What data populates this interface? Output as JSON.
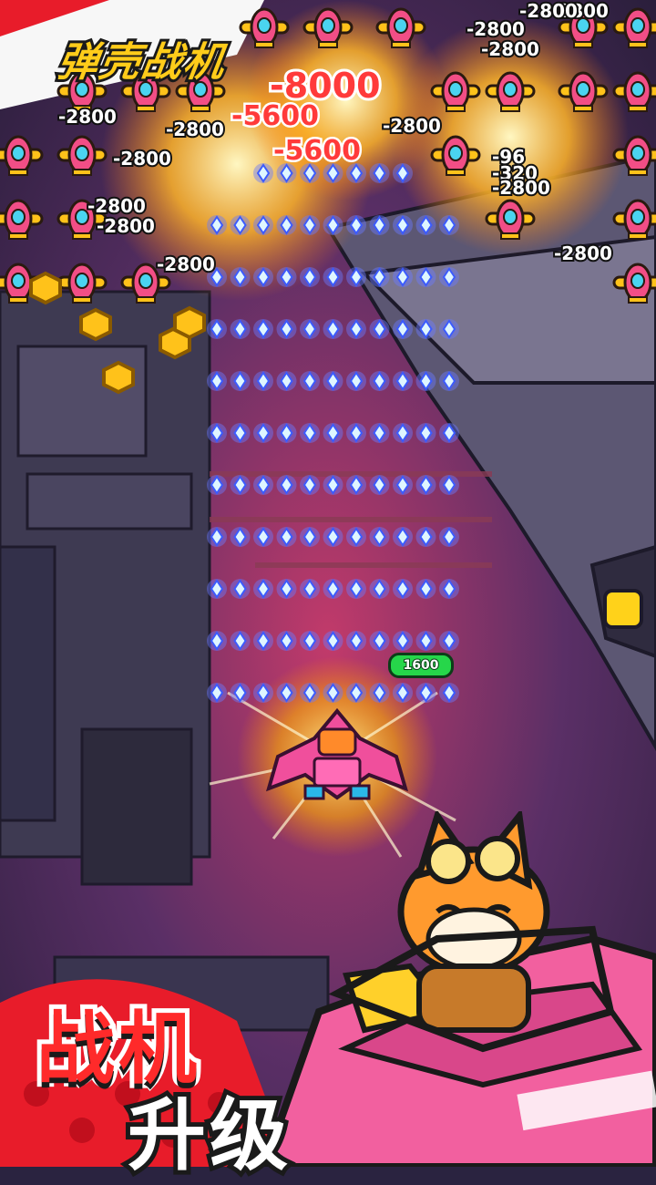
{
  "game": {
    "logo_text": "弹壳战机",
    "promo_line1": "战机",
    "promo_line2": "升级",
    "player_hp": "1600"
  },
  "damage_numbers": [
    {
      "text": "-8000",
      "style": "big"
    },
    {
      "text": "-5600",
      "style": "mid"
    },
    {
      "text": "-5600",
      "style": "mid"
    },
    {
      "text": "-2800",
      "style": "sm"
    },
    {
      "text": "-2800",
      "style": "sm"
    },
    {
      "text": "-2800",
      "style": "sm"
    },
    {
      "text": "-2800",
      "style": "sm"
    },
    {
      "text": "-2800",
      "style": "sm"
    },
    {
      "text": "-2800",
      "style": "sm"
    },
    {
      "text": "-2800",
      "style": "sm"
    },
    {
      "text": "-2800",
      "style": "sm"
    },
    {
      "text": "-2800",
      "style": "sm"
    },
    {
      "text": "-2800",
      "style": "sm"
    },
    {
      "text": "-2800",
      "style": "sm"
    },
    {
      "text": "-2800",
      "style": "sm"
    },
    {
      "text": "-96",
      "style": "sm"
    },
    {
      "text": "-320",
      "style": "sm"
    },
    {
      "text": "-2800",
      "style": "sm"
    }
  ],
  "colors": {
    "background": "#2a2340",
    "promo_red": "#ff2a2a",
    "logo_yellow": "#ffcc1a",
    "hp_green": "#26d64a",
    "player_ship_pink": "#f04f9c"
  },
  "icons": [
    "enemy-plane-icon",
    "coin-icon",
    "bullet-icon",
    "player-ship-icon",
    "fox-pilot-icon"
  ]
}
